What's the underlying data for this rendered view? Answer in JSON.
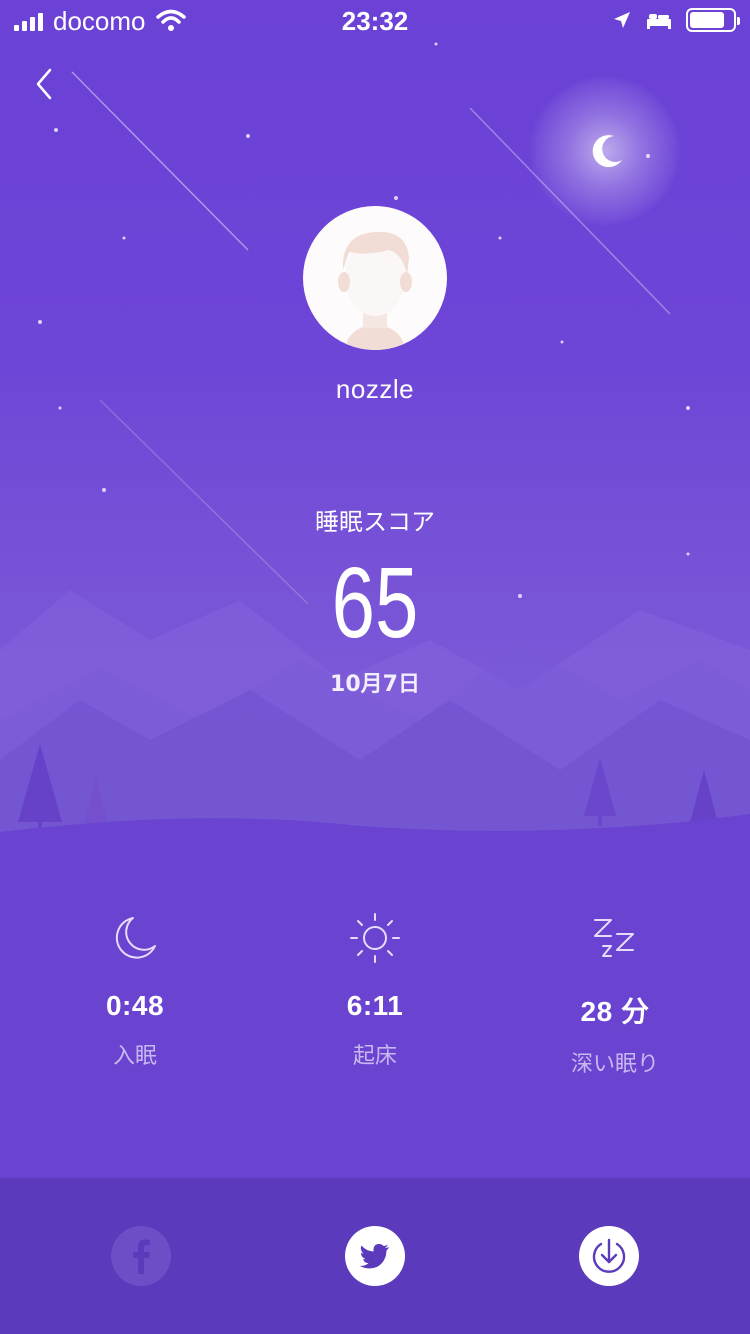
{
  "status_bar": {
    "carrier": "docomo",
    "time": "23:32",
    "battery_level": 0.8
  },
  "header": {
    "back_icon": "chevron-left-icon"
  },
  "profile": {
    "username": "nozzle",
    "avatar_icon": "default-avatar-icon"
  },
  "sleep_score": {
    "label": "睡眠スコア",
    "value": "65",
    "date": "10月7日"
  },
  "stats": [
    {
      "icon": "moon-icon",
      "value": "0:48",
      "label": "入眠"
    },
    {
      "icon": "sun-icon",
      "value": "6:11",
      "label": "起床"
    },
    {
      "icon": "zzz-icon",
      "value": "28 分",
      "label": "深い眠り"
    }
  ],
  "share": {
    "buttons": [
      "facebook-icon",
      "twitter-icon",
      "download-icon"
    ]
  },
  "colors": {
    "background": "#6a44d0",
    "bottom_bar": "#5b3bbb",
    "accent_text": "#c8b8f0"
  }
}
